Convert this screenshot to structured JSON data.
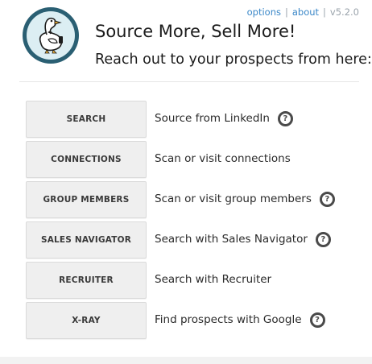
{
  "header": {
    "options_label": "options",
    "about_label": "about",
    "version": "v5.2.0",
    "title": "Source More, Sell More!",
    "subtitle": "Reach out to your prospects from here:"
  },
  "logo": {
    "icon": "duck-logo-icon",
    "colors": {
      "ring": "#2a5f73",
      "bg": "#dceef3"
    }
  },
  "actions": [
    {
      "button": "SEARCH",
      "description": "Source from LinkedIn",
      "help": true
    },
    {
      "button": "CONNECTIONS",
      "description": "Scan or visit connections",
      "help": false
    },
    {
      "button": "GROUP MEMBERS",
      "description": "Scan or visit group members",
      "help": true
    },
    {
      "button": "SALES NAVIGATOR",
      "description": "Search with Sales Navigator",
      "help": true
    },
    {
      "button": "RECRUITER",
      "description": "Search with Recruiter",
      "help": false
    },
    {
      "button": "X-RAY",
      "description": "Find prospects with Google",
      "help": true
    }
  ],
  "help_icon_glyph": "?"
}
